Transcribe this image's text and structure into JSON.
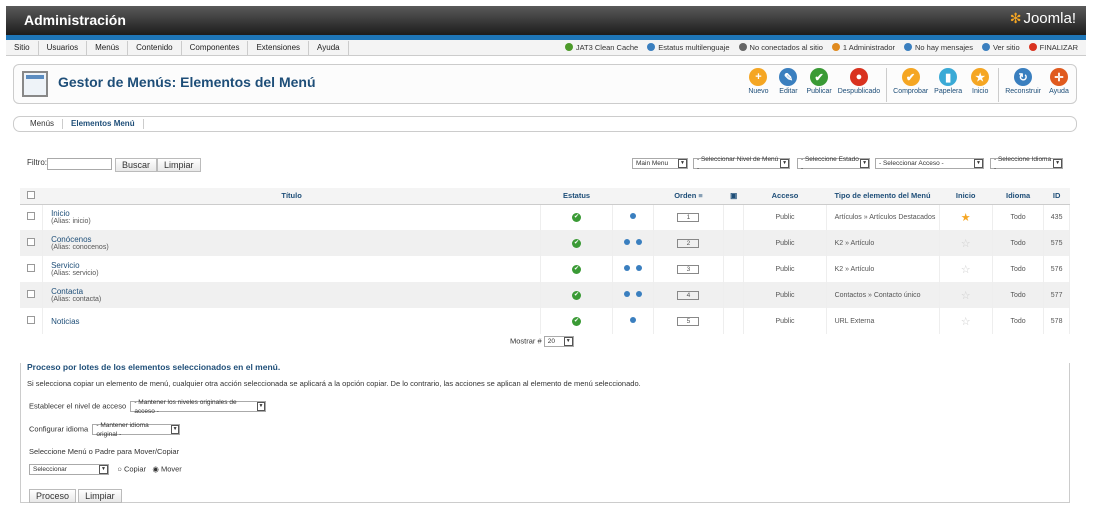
{
  "header": {
    "title": "Administración",
    "logo": "Joomla!"
  },
  "menubar": [
    "Sitio",
    "Usuarios",
    "Menús",
    "Contenido",
    "Componentes",
    "Extensiones",
    "Ayuda"
  ],
  "status": [
    {
      "label": "JAT3 Clean Cache",
      "color": "#4c9a2a"
    },
    {
      "label": "Estatus multilenguaje",
      "color": "#3a7fbf"
    },
    {
      "label": "No conectados al sitio",
      "color": "#666"
    },
    {
      "label": "1 Administrador",
      "color": "#e08a1e"
    },
    {
      "label": "No hay mensajes",
      "color": "#3a7fbf"
    },
    {
      "label": "Ver sitio",
      "color": "#3a7fbf"
    },
    {
      "label": "FINALIZAR",
      "color": "#d9321f"
    }
  ],
  "toolbar": {
    "title": "Gestor de Menús: Elementos del Menú",
    "buttons": [
      {
        "label": "Nuevo",
        "color": "#f5a623",
        "icon": "+"
      },
      {
        "label": "Editar",
        "color": "#3a7fbf",
        "icon": "✎"
      },
      {
        "label": "Publicar",
        "color": "#3a9a35",
        "icon": "✔"
      },
      {
        "label": "Despublicado",
        "color": "#d9321f",
        "icon": "●"
      },
      {
        "label": "Comprobar",
        "color": "#f5a623",
        "icon": "✔"
      },
      {
        "label": "Papelera",
        "color": "#3aaad6",
        "icon": "▮"
      },
      {
        "label": "Inicio",
        "color": "#f5a623",
        "icon": "★"
      },
      {
        "label": "Reconstruir",
        "color": "#3a7fbf",
        "icon": "↻"
      },
      {
        "label": "Ayuda",
        "color": "#e05a1e",
        "icon": "✛"
      }
    ]
  },
  "subnav": {
    "items": [
      "Menús",
      "Elementos Menú"
    ]
  },
  "filters": {
    "label": "Filtro:",
    "search": "Buscar",
    "clear": "Limpiar",
    "selects": [
      "Main Menu",
      "- Seleccionar Nivel de Menú -",
      "- Seleccione Estado -",
      "- Seleccionar Acceso -",
      "- Seleccione Idioma -"
    ]
  },
  "table": {
    "headers": [
      "Título",
      "Estatus",
      "Orden",
      "Acceso",
      "Tipo de elemento del Menú",
      "Inicio",
      "Idioma",
      "ID"
    ],
    "rows": [
      {
        "title": "Inicio",
        "alias": "(Alias: inicio)",
        "order": "1",
        "access": "Public",
        "type": "Artículos » Artículos Destacados",
        "home": true,
        "lang": "Todo",
        "id": "435",
        "arrows": 1
      },
      {
        "title": "Conócenos",
        "alias": "(Alias: conocenos)",
        "order": "2",
        "access": "Public",
        "type": "K2 » Artículo",
        "home": false,
        "lang": "Todo",
        "id": "575",
        "arrows": 2
      },
      {
        "title": "Servicio",
        "alias": "(Alias: servicio)",
        "order": "3",
        "access": "Public",
        "type": "K2 » Artículo",
        "home": false,
        "lang": "Todo",
        "id": "576",
        "arrows": 2
      },
      {
        "title": "Contacta",
        "alias": "(Alias: contacta)",
        "order": "4",
        "access": "Public",
        "type": "Contactos » Contacto único",
        "home": false,
        "lang": "Todo",
        "id": "577",
        "arrows": 2
      },
      {
        "title": "Noticias",
        "alias": "",
        "order": "5",
        "access": "Public",
        "type": "URL Externa",
        "home": false,
        "lang": "Todo",
        "id": "578",
        "arrows": 1
      }
    ]
  },
  "pager": {
    "label": "Mostrar #",
    "value": "20"
  },
  "batch": {
    "title": "Proceso por lotes de los elementos seleccionados en el menú.",
    "desc": "Si selecciona copiar un elemento de menú, cualquier otra acción seleccionada se aplicará a la opción copiar. De lo contrario, las acciones se aplican al elemento de menú seleccionado.",
    "access_label": "Establecer el nivel de acceso",
    "access_value": "- Mantener los niveles originales de acceso -",
    "lang_label": "Configurar idioma",
    "lang_value": "- Mantener idioma original -",
    "move_label": "Seleccione Menú o Padre para Mover/Copiar",
    "move_value": "Seleccionar",
    "copy": "Copiar",
    "move": "Mover",
    "process": "Proceso",
    "clear": "Limpiar"
  }
}
